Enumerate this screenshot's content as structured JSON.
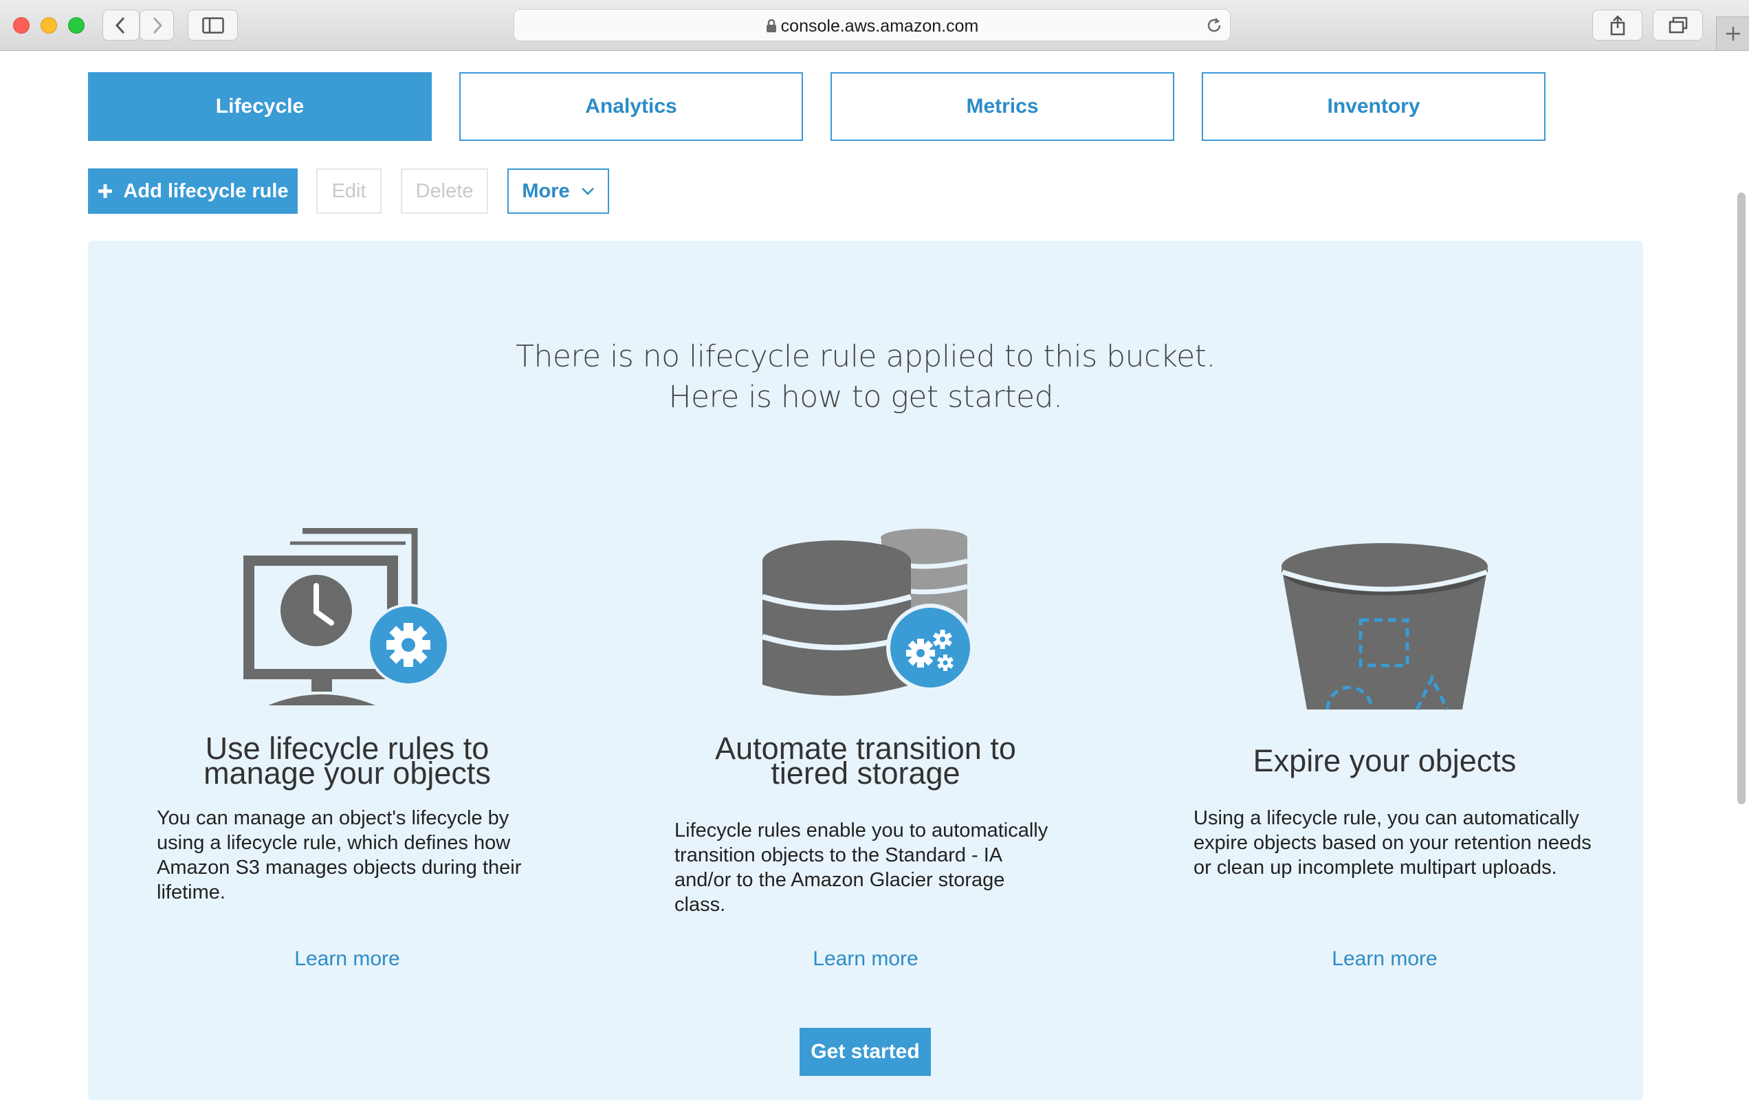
{
  "browser": {
    "url": "console.aws.amazon.com"
  },
  "tabs": [
    {
      "label": "Lifecycle",
      "active": true
    },
    {
      "label": "Analytics",
      "active": false
    },
    {
      "label": "Metrics",
      "active": false
    },
    {
      "label": "Inventory",
      "active": false
    }
  ],
  "toolbar": {
    "add_label": "Add lifecycle rule",
    "edit_label": "Edit",
    "delete_label": "Delete",
    "more_label": "More"
  },
  "intro": {
    "line1": "There is no lifecycle rule applied to this bucket.",
    "line2": "Here is how to get started."
  },
  "features": [
    {
      "icon": "monitor-clock-gear-icon",
      "title_line1": "Use lifecycle rules to",
      "title_line2": "manage your objects",
      "description": "You can manage an object's lifecycle by using a lifecycle rule, which defines how Amazon S3 manages objects during their lifetime.",
      "link": "Learn more"
    },
    {
      "icon": "database-gears-icon",
      "title_line1": "Automate transition to",
      "title_line2": "tiered storage",
      "description": "Lifecycle rules enable you to automatically transition objects to the Standard - IA and/or to the Amazon Glacier storage class.",
      "link": "Learn more"
    },
    {
      "icon": "bucket-objects-icon",
      "title_line1": "Expire your objects",
      "title_line2": "",
      "description": "Using a lifecycle rule, you can automatically expire objects based on your retention needs or clean up incomplete multipart uploads.",
      "link": "Learn more"
    }
  ],
  "get_started_label": "Get started",
  "colors": {
    "accent": "#3a9bd5",
    "link": "#2b8cc8",
    "panel_bg": "#e8f4fb",
    "icon_gray": "#6b6b6b"
  }
}
